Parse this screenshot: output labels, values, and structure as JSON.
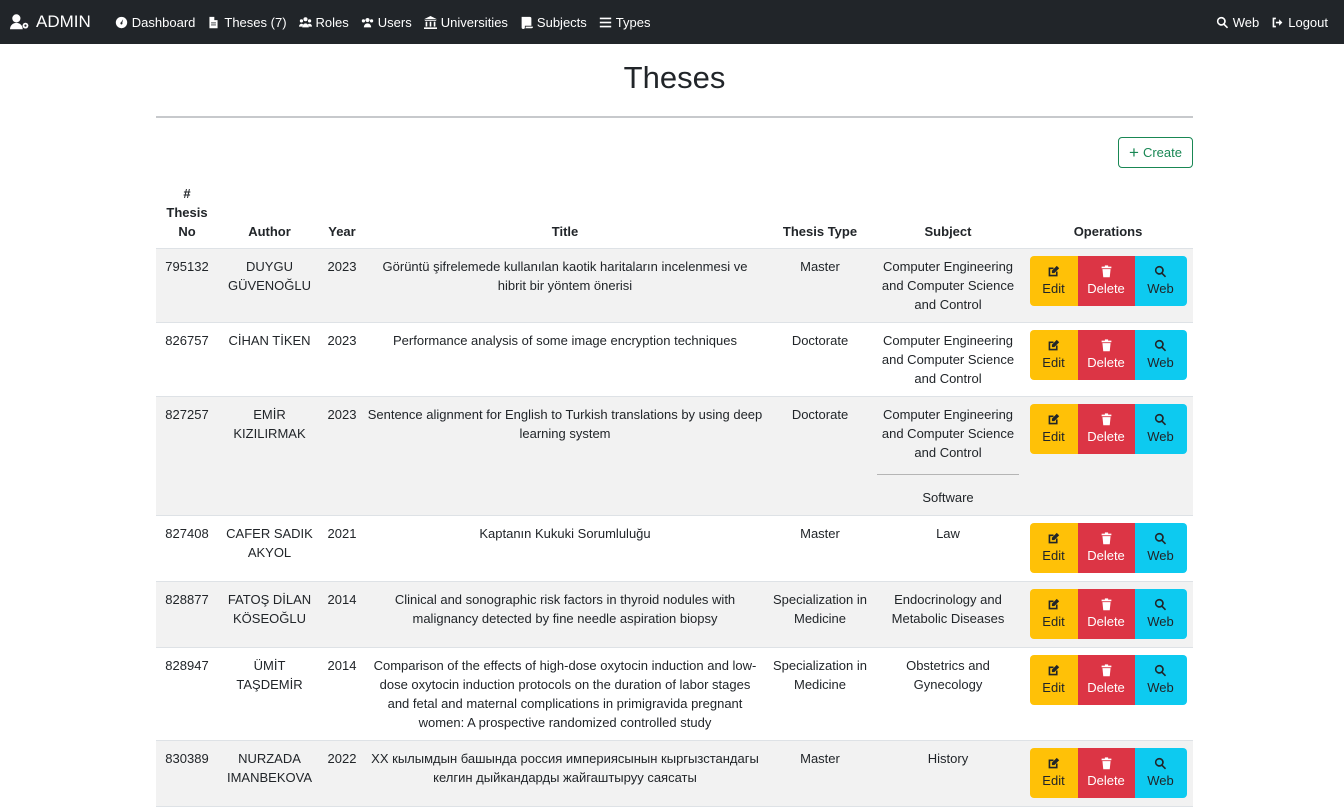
{
  "nav": {
    "brand": "ADMIN",
    "links": [
      {
        "label": "Dashboard"
      },
      {
        "label": "Theses (7)"
      },
      {
        "label": "Roles"
      },
      {
        "label": "Users"
      },
      {
        "label": "Universities"
      },
      {
        "label": "Subjects"
      },
      {
        "label": "Types"
      }
    ],
    "right": [
      {
        "label": "Web"
      },
      {
        "label": "Logout"
      }
    ]
  },
  "page": {
    "title": "Theses",
    "create_label": "Create"
  },
  "table": {
    "headers": {
      "no_hash": "#",
      "no_label": "Thesis No",
      "author": "Author",
      "year": "Year",
      "title": "Title",
      "type": "Thesis Type",
      "subject": "Subject",
      "operations": "Operations"
    },
    "ops": {
      "edit": "Edit",
      "delete": "Delete",
      "web": "Web"
    },
    "rows": [
      {
        "no": "795132",
        "author": "DUYGU GÜVENOĞLU",
        "year": "2023",
        "title": "Görüntü şifrelemede kullanılan kaotik haritaların incelenmesi ve hibrit bir yöntem önerisi",
        "type": "Master",
        "subjects": [
          "Computer Engineering and Computer Science and Control"
        ]
      },
      {
        "no": "826757",
        "author": "CİHAN TİKEN",
        "year": "2023",
        "title": "Performance analysis of some image encryption techniques",
        "type": "Doctorate",
        "subjects": [
          "Computer Engineering and Computer Science and Control"
        ]
      },
      {
        "no": "827257",
        "author": "EMİR KIZILIRMAK",
        "year": "2023",
        "title": "Sentence alignment for English to Turkish translations by using deep learning system",
        "type": "Doctorate",
        "subjects": [
          "Computer Engineering and Computer Science and Control",
          "Software"
        ]
      },
      {
        "no": "827408",
        "author": "CAFER SADIK AKYOL",
        "year": "2021",
        "title": "Kaptanın Kukuki Sorumluluğu",
        "type": "Master",
        "subjects": [
          "Law"
        ]
      },
      {
        "no": "828877",
        "author": "FATOŞ DİLAN KÖSEOĞLU",
        "year": "2014",
        "title": "Clinical and sonographic risk factors in thyroid nodules with malignancy detected by fine needle aspiration biopsy",
        "type": "Specialization in Medicine",
        "subjects": [
          "Endocrinology and Metabolic Diseases"
        ]
      },
      {
        "no": "828947",
        "author": "ÜMİT TAŞDEMİR",
        "year": "2014",
        "title": "Comparison of the effects of high-dose oxytocin induction and low-dose oxytocin induction protocols on the duration of labor stages and fetal and maternal complications in primigravida pregnant women: A prospective randomized controlled study",
        "type": "Specialization in Medicine",
        "subjects": [
          "Obstetrics and Gynecology"
        ]
      },
      {
        "no": "830389",
        "author": "NURZADA IMANBEKOVA",
        "year": "2022",
        "title": "XX кылымдын башында россия империясынын кыргызстандагы келгин дыйкандарды жайгаштыруу саясаты",
        "type": "Master",
        "subjects": [
          "History"
        ]
      }
    ]
  }
}
